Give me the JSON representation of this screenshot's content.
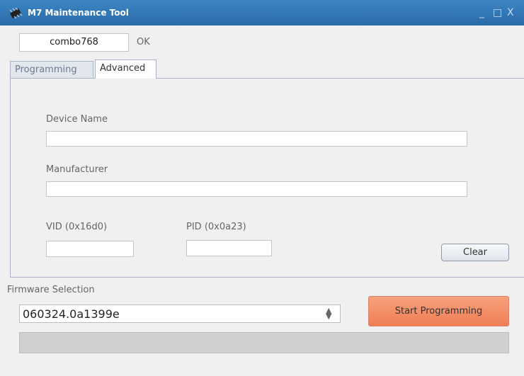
{
  "window": {
    "title": "M7 Maintenance Tool",
    "minimize": "_",
    "maximize": "□",
    "close": "X"
  },
  "device": {
    "name_value": "combo768",
    "status": "OK"
  },
  "tabs": [
    {
      "label": "Programming",
      "active": false
    },
    {
      "label": "Advanced",
      "active": true
    }
  ],
  "advanced": {
    "device_name_label": "Device Name",
    "device_name_value": "",
    "manufacturer_label": "Manufacturer",
    "manufacturer_value": "",
    "vid_label": "VID (0x16d0)",
    "vid_value": "",
    "pid_label": "PID (0x0a23)",
    "pid_value": "",
    "clear_button": "Clear"
  },
  "firmware": {
    "label": "Firmware Selection",
    "selected": "060324.0a1399e",
    "start_button": "Start Programming",
    "progress": 0
  },
  "colors": {
    "titlebar": "#2f74b5",
    "start_button": "#f28a61",
    "progress_track": "#cfcfcf"
  }
}
